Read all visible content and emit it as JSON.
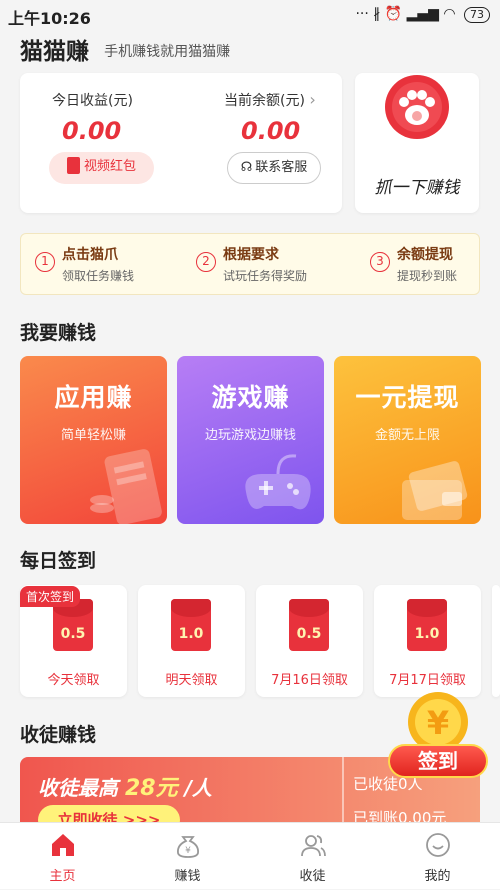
{
  "status_bar": {
    "time": "上午10:26",
    "icons": "··· ∦ ⏰ ▂▄▆ ◠",
    "battery": "73"
  },
  "header": {
    "title": "猫猫赚",
    "subtitle": "手机赚钱就用猫猫赚"
  },
  "earnings": {
    "today_label": "今日收益(元)",
    "today_value": "0.00",
    "balance_label": "当前余额(元)",
    "balance_value": "0.00",
    "video_btn": "视频红包",
    "service_btn": "联系客服"
  },
  "grab": {
    "label": "抓一下赚钱"
  },
  "steps": [
    {
      "num": "1",
      "title": "点击猫爪",
      "desc": "领取任务赚钱"
    },
    {
      "num": "2",
      "title": "根据要求",
      "desc": "试玩任务得奖励"
    },
    {
      "num": "3",
      "title": "余额提现",
      "desc": "提现秒到账"
    }
  ],
  "earn_section": {
    "title": "我要赚钱"
  },
  "tiles": [
    {
      "name": "应用赚",
      "sub": "简单轻松赚"
    },
    {
      "name": "游戏赚",
      "sub": "边玩游戏边赚钱"
    },
    {
      "name": "一元提现",
      "sub": "金额无上限"
    }
  ],
  "signin_section": {
    "title": "每日签到",
    "first_tag": "首次签到"
  },
  "signin": [
    {
      "amount": "0.5",
      "day": "今天领取"
    },
    {
      "amount": "1.0",
      "day": "明天领取"
    },
    {
      "amount": "0.5",
      "day": "7月16日领取"
    },
    {
      "amount": "1.0",
      "day": "7月17日领取"
    }
  ],
  "float_sign": {
    "label": "签到"
  },
  "invite_section": {
    "title": "收徒赚钱"
  },
  "invite": {
    "headline_a": "收徒最高",
    "headline_amount": "28元",
    "headline_b": "/人",
    "button": "立即收徒 >>>",
    "stat1": "已收徒0人",
    "stat2": "已到账0.00元"
  },
  "tabs": [
    {
      "label": "主页"
    },
    {
      "label": "赚钱"
    },
    {
      "label": "收徒"
    },
    {
      "label": "我的"
    }
  ],
  "colors": {
    "accent": "#e8323c",
    "tile1": "#f6643f",
    "tile2": "#8f62f2",
    "tile3": "#fba824"
  }
}
